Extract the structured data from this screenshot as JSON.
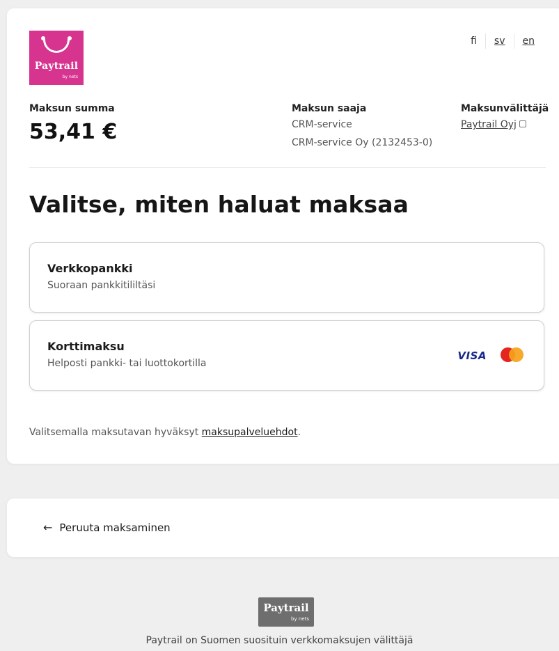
{
  "logo": {
    "brand": "Paytrail",
    "by": "by nets"
  },
  "languages": [
    "fi",
    "sv",
    "en"
  ],
  "payment": {
    "amount_label": "Maksun summa",
    "amount": "53,41 €",
    "recipient_label": "Maksun saaja",
    "recipient_name": "CRM-service",
    "recipient_company": "CRM-service Oy (2132453-0)",
    "provider_label": "Maksunvälittäjä",
    "provider_link": "Paytrail Oyj"
  },
  "heading": "Valitse, miten haluat maksaa",
  "options": [
    {
      "title": "Verkkopankki",
      "desc": "Suoraan pankkitililtäsi"
    },
    {
      "title": "Korttimaksu",
      "desc": "Helposti pankki- tai luottokortilla",
      "visa": "VISA"
    }
  ],
  "terms": {
    "text": "Valitsemalla maksutavan hyväksyt ",
    "link": "maksupalveluehdot",
    "suffix": "."
  },
  "cancel": {
    "arrow": "←",
    "label": "Peruuta maksaminen"
  },
  "footer": {
    "brand": "Paytrail",
    "by": "by nets",
    "text": "Paytrail on Suomen suosituin verkkomaksujen välittäjä"
  },
  "colors": {
    "brand": "#d6348f",
    "background": "#efefef",
    "visa": "#1a2a8a"
  }
}
